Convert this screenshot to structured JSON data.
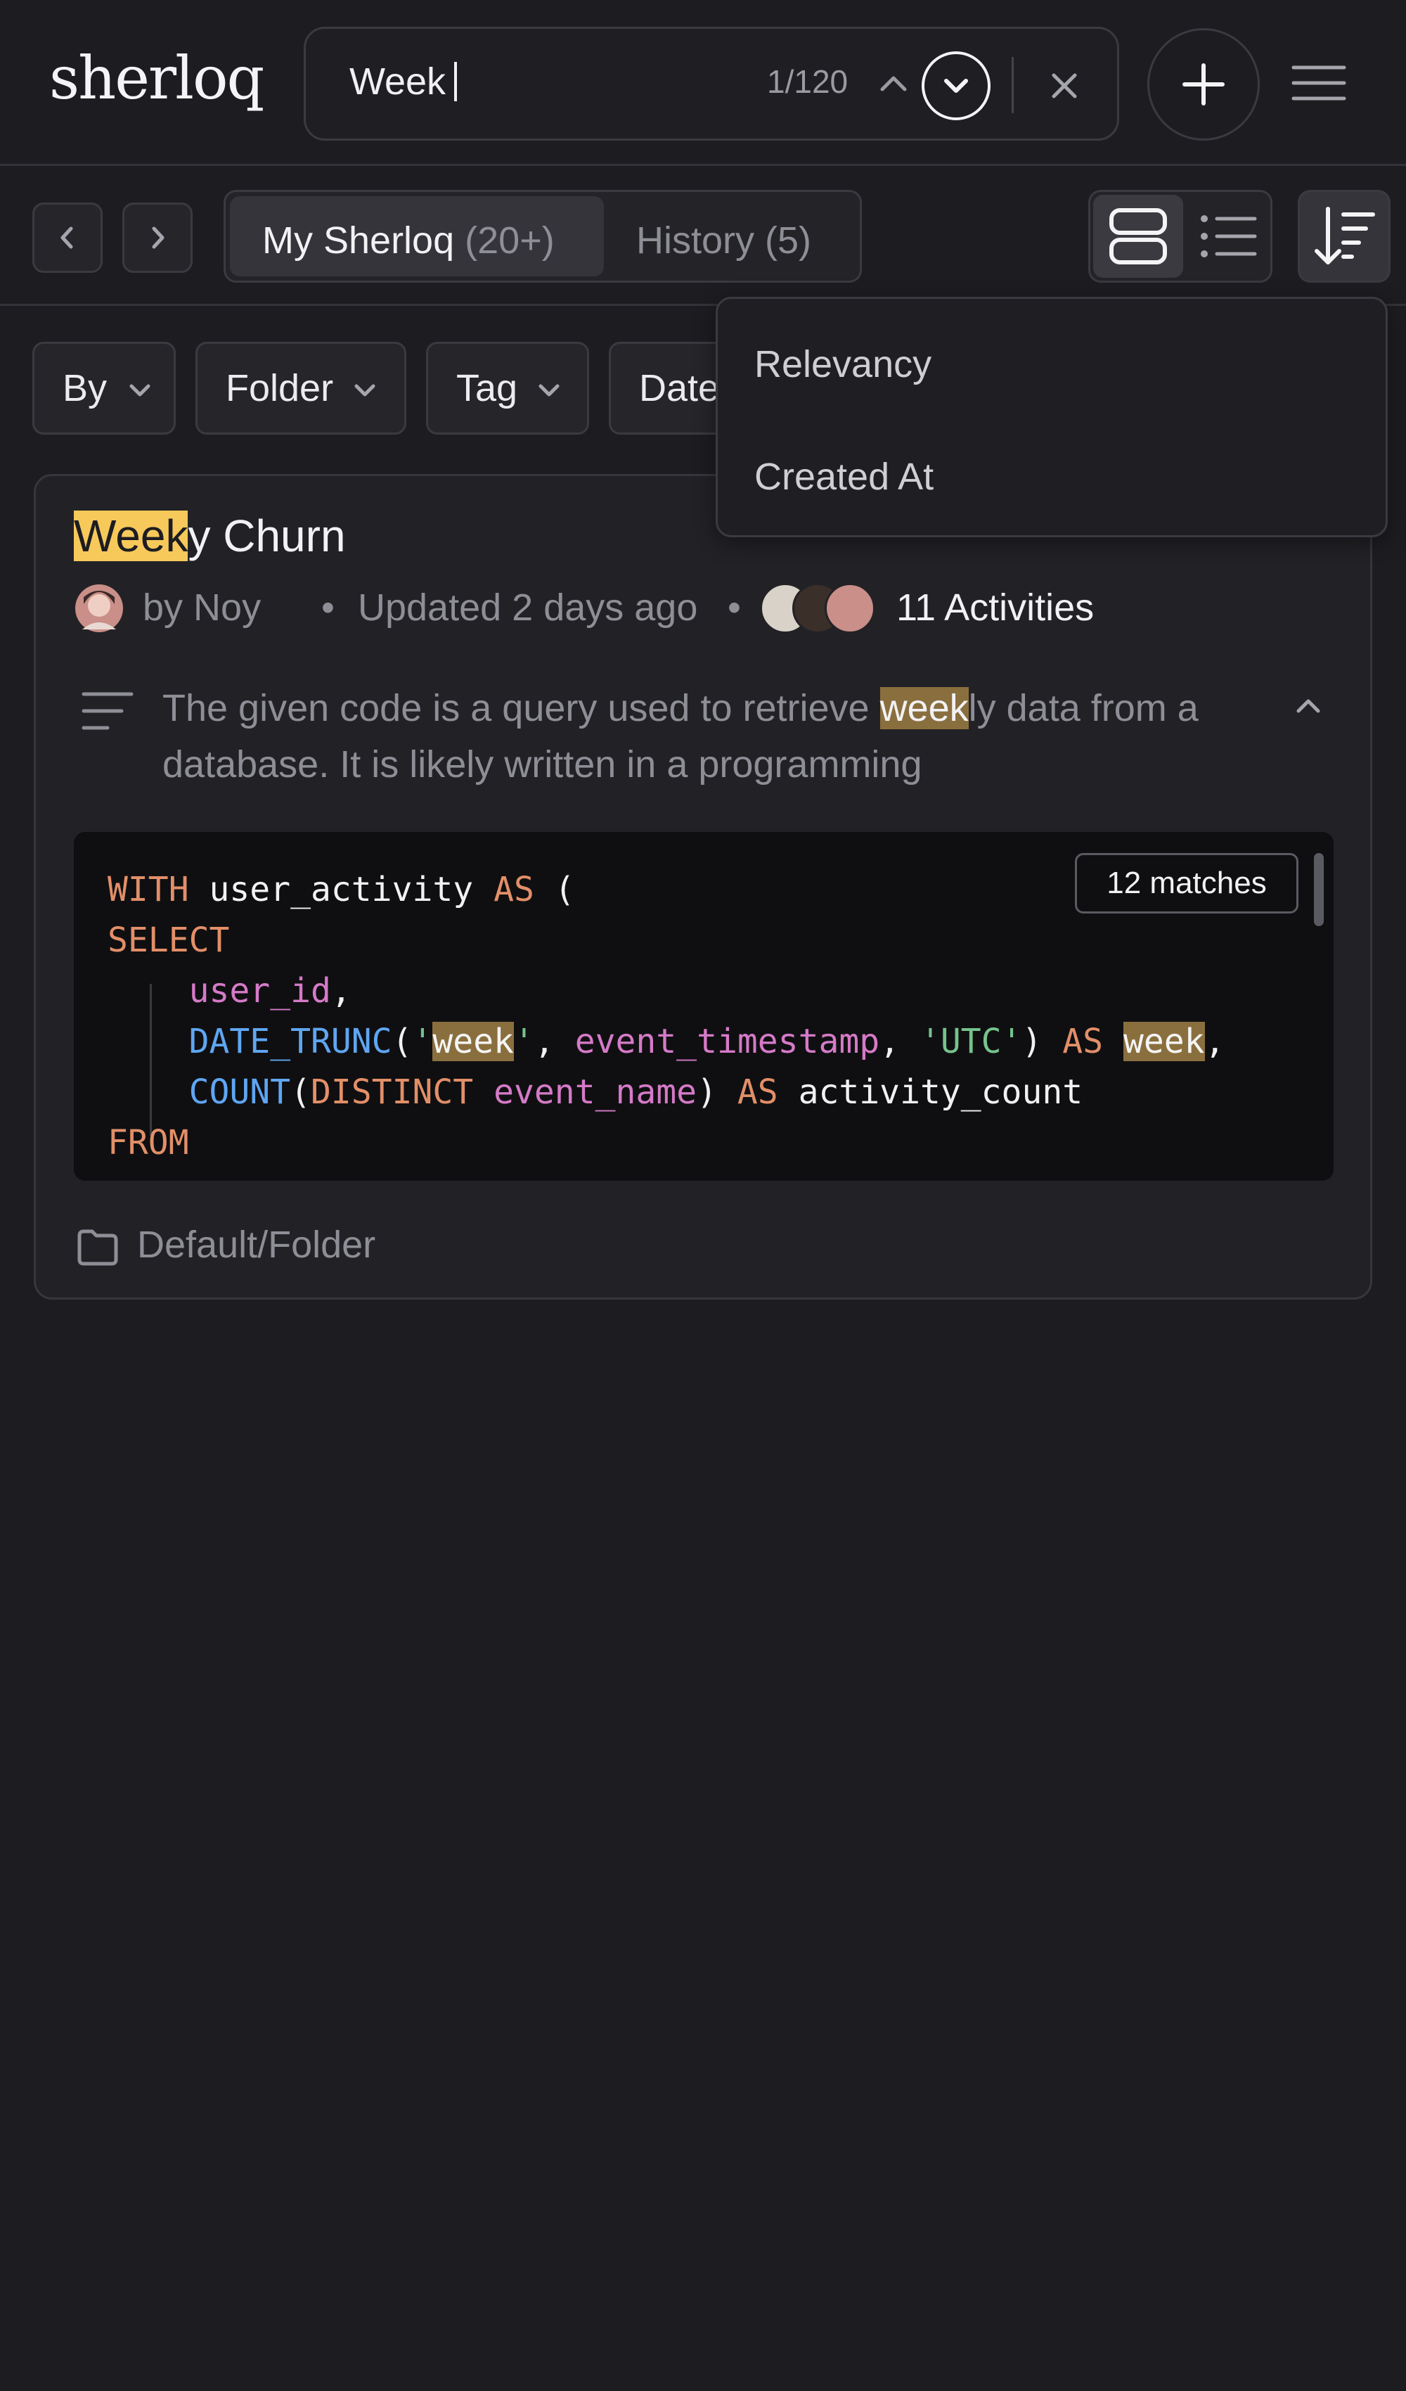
{
  "header": {
    "logo": "sherloq",
    "search_value": "Week",
    "match_position": "1/120"
  },
  "toolbar": {
    "tabs": [
      {
        "label": "My Sherloq",
        "count": "(20+)",
        "active": true
      },
      {
        "label": "History",
        "count": "(5)",
        "active": false
      }
    ],
    "view_active": "card-view"
  },
  "filters": [
    "By",
    "Folder",
    "Tag",
    "Date"
  ],
  "sort_menu": {
    "options": [
      "Relevancy",
      "Created At"
    ]
  },
  "card": {
    "title_highlight": "Week",
    "title_rest": "y Churn",
    "author": "by Noy",
    "updated": "Updated 2 days ago",
    "activities": "11 Activities",
    "description_before": "The given code is a query used to retrieve ",
    "description_highlight": "week",
    "description_after": "ly data from a database. It is likely written in a programming",
    "code_matches": "12 matches",
    "code": {
      "l1_kw1": "WITH",
      "l1_name": " user_activity ",
      "l1_kw2": "AS",
      "l1_paren": " (",
      "l2_kw": "SELECT",
      "l3_id": "user_id",
      "l3_comma": ",",
      "l4_fn": "DATE_TRUNC",
      "l4_open": "(",
      "l4_q1": "'",
      "l4_hl1": "week",
      "l4_q2": "'",
      "l4_sep": ", ",
      "l4_id": "event_timestamp",
      "l4_sep2": ", ",
      "l4_str": "'UTC'",
      "l4_close": ") ",
      "l4_kw": "AS",
      "l4_sp": " ",
      "l4_hl2": "week",
      "l4_end": ",",
      "l5_fn": "COUNT",
      "l5_open": "(",
      "l5_kw": "DISTINCT",
      "l5_sp": " ",
      "l5_id": "event_name",
      "l5_close": ") ",
      "l5_kw2": "AS",
      "l5_name": " activity_count",
      "l6_kw": "FROM"
    },
    "folder": "Default/Folder"
  }
}
